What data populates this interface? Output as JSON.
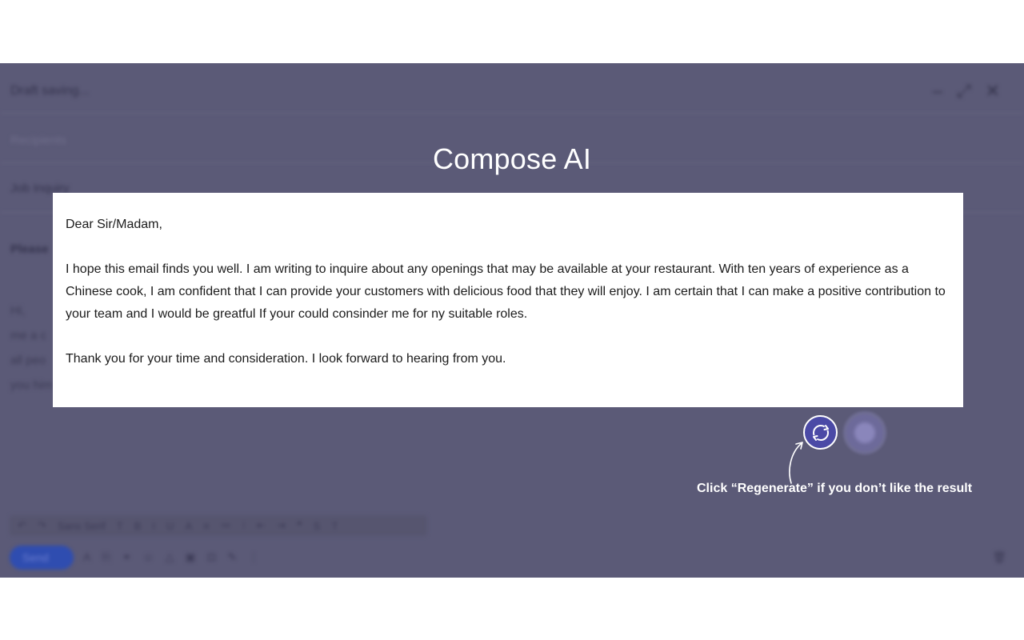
{
  "background_composer": {
    "status": "Draft saving...",
    "recipients_placeholder": "Recipients",
    "subject": "Job Inquiry",
    "prompt_line": "Please",
    "body_lines": [
      "Hi,",
      "me a c",
      "all peo",
      "you him"
    ],
    "font_label": "Sans Serif",
    "send_label": "Send"
  },
  "overlay": {
    "title": "Compose AI",
    "generated_email": {
      "greeting": "Dear Sir/Madam,",
      "paragraph_1": "I hope this email finds you well. I am writing to inquire about any openings that may be available at your restaurant. With ten years of experience as a Chinese cook, I am confident that I can provide your customers with delicious food that they will enjoy. I am certain that I can make a positive contribution to your team and I would be greatful If your could consinder me for ny suitable roles.",
      "paragraph_2": "Thank you for your time and consideration. I look forward to hearing from you."
    },
    "regenerate_icon": "refresh-icon",
    "hint": "Click “Regenerate” if you don’t like the result"
  },
  "colors": {
    "overlay_background": "#5b5a77",
    "regenerate_button": "#4b4aa6",
    "card": "#ffffff"
  }
}
